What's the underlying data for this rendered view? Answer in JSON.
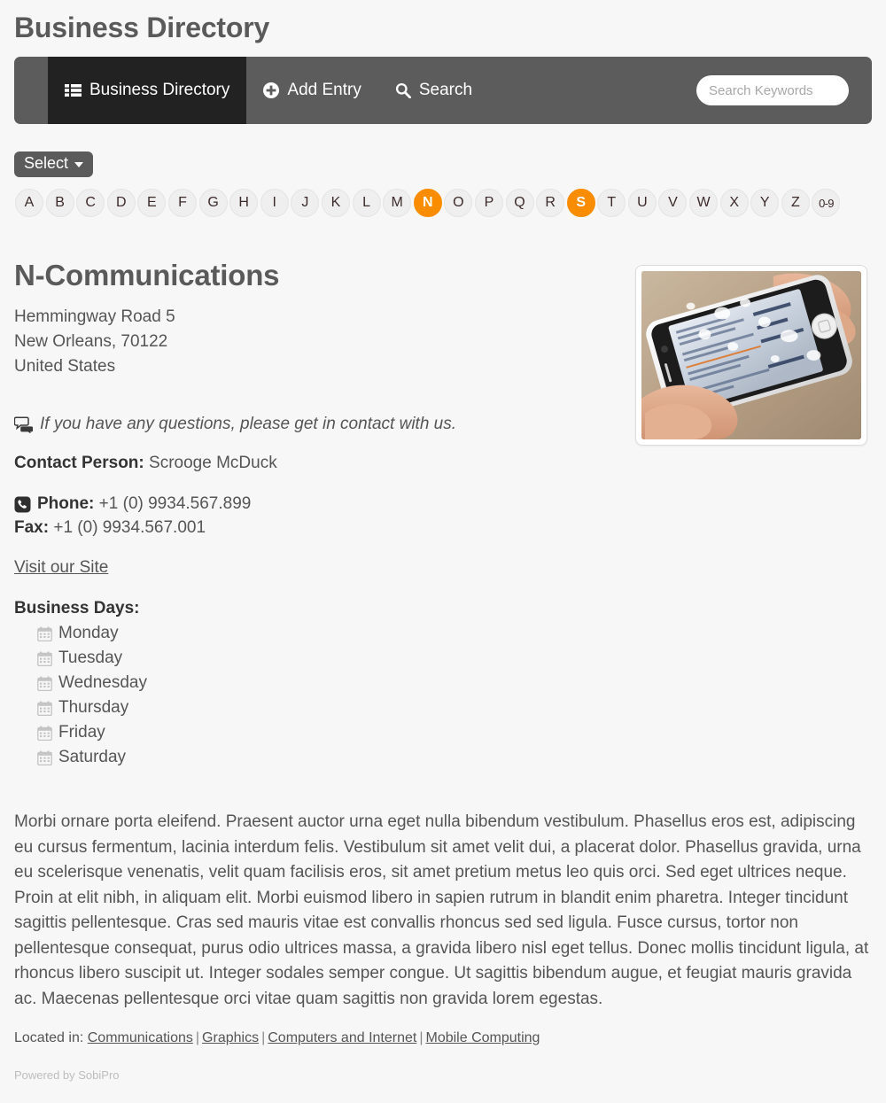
{
  "header": {
    "title": "Business Directory"
  },
  "navbar": {
    "items": [
      {
        "label": "Business Directory",
        "icon": "list-grid-icon",
        "active": true
      },
      {
        "label": "Add Entry",
        "icon": "plus-circle-icon",
        "active": false
      },
      {
        "label": "Search",
        "icon": "search-icon",
        "active": false
      }
    ],
    "search_placeholder": "Search Keywords",
    "search_value": "",
    "background": "#5c5c5c",
    "active_background": "#222222"
  },
  "filters": {
    "select_label": "Select",
    "letters": [
      "A",
      "B",
      "C",
      "D",
      "E",
      "F",
      "G",
      "H",
      "I",
      "J",
      "K",
      "L",
      "M",
      "N",
      "O",
      "P",
      "Q",
      "R",
      "S",
      "T",
      "U",
      "V",
      "W",
      "X",
      "Y",
      "Z",
      "0-9"
    ],
    "active_letters": [
      "N",
      "S"
    ],
    "accent_color": "#fa8c00"
  },
  "entry": {
    "title": "N-Communications",
    "address": {
      "street": "Hemmingway Road 5",
      "city_zip": "New Orleans, 70122",
      "country": "United States"
    },
    "questions_note": "If you have any questions, please get in contact with us.",
    "contact_person_label": "Contact Person:",
    "contact_person_value": "Scrooge McDuck",
    "phone_label": "Phone:",
    "phone_value": "+1 (0) 9934.567.899",
    "fax_label": "Fax:",
    "fax_value": "+1 (0) 9934.567.001",
    "website_link": "Visit our Site",
    "business_days_label": "Business Days:",
    "business_days": [
      "Monday",
      "Tuesday",
      "Wednesday",
      "Thursday",
      "Friday",
      "Saturday"
    ],
    "description": "Morbi ornare porta eleifend. Praesent auctor urna eget nulla bibendum vestibulum. Phasellus eros est, adipiscing eu cursus fermentum, lacinia interdum felis. Vestibulum sit amet velit dui, a placerat dolor. Phasellus gravida, urna eu scelerisque venenatis, velit quam facilisis eros, sit amet pretium metus leo quis orci. Sed eget ultrices neque. Proin at elit nibh, in aliquam elit. Morbi euismod libero in sapien rutrum in blandit enim pharetra. Integer tincidunt sagittis pellentesque. Cras sed mauris vitae est convallis rhoncus sed sed ligula. Fusce cursus, tortor non pellentesque consequat, purus odio ultrices massa, a gravida libero nisl eget tellus. Donec mollis tincidunt ligula, at rhoncus libero suscipit ut. Integer sodales semper congue. Ut sagittis bibendum augue, et feugiat mauris gravida ac. Maecenas pellentesque orci vitae quam sagittis non gravida lorem egestas.",
    "thumbnail_alt": "hand holding white smartphone"
  },
  "located": {
    "label": "Located in:",
    "categories": [
      "Communications",
      "Graphics",
      "Computers and Internet",
      "Mobile Computing"
    ],
    "separator": "|"
  },
  "footer": {
    "powered_by": "Powered by SobiPro"
  }
}
